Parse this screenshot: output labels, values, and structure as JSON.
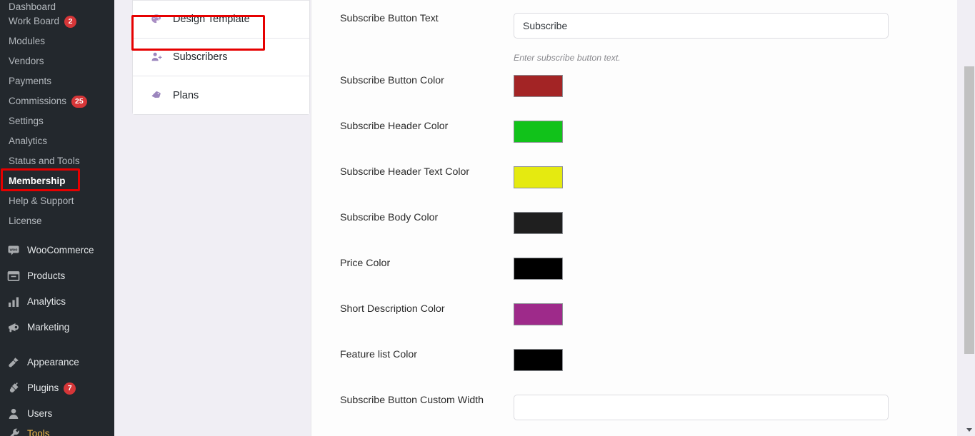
{
  "sidebar": {
    "items": [
      {
        "label": "Dashboard",
        "badge": null,
        "icon": null,
        "partial_top": true
      },
      {
        "label": "Work Board",
        "badge": "2",
        "icon": null
      },
      {
        "label": "Modules",
        "badge": null,
        "icon": null
      },
      {
        "label": "Vendors",
        "badge": null,
        "icon": null
      },
      {
        "label": "Payments",
        "badge": null,
        "icon": null
      },
      {
        "label": "Commissions",
        "badge": "25",
        "icon": null
      },
      {
        "label": "Settings",
        "badge": null,
        "icon": null
      },
      {
        "label": "Analytics",
        "badge": null,
        "icon": null
      },
      {
        "label": "Status and Tools",
        "badge": null,
        "icon": null
      },
      {
        "label": "Membership",
        "badge": null,
        "icon": null,
        "highlighted": true
      },
      {
        "label": "Help & Support",
        "badge": null,
        "icon": null
      },
      {
        "label": "License",
        "badge": null,
        "icon": null
      }
    ],
    "top_items": [
      {
        "label": "WooCommerce",
        "badge": null,
        "icon": "woocommerce-icon"
      },
      {
        "label": "Products",
        "badge": null,
        "icon": "products-icon"
      },
      {
        "label": "Analytics",
        "badge": null,
        "icon": "analytics-bars-icon"
      },
      {
        "label": "Marketing",
        "badge": null,
        "icon": "megaphone-icon"
      },
      {
        "label": "Appearance",
        "badge": null,
        "icon": "paintbrush-icon"
      },
      {
        "label": "Plugins",
        "badge": "7",
        "icon": "plug-icon"
      },
      {
        "label": "Users",
        "badge": null,
        "icon": "user-icon"
      },
      {
        "label": "Tools",
        "badge": null,
        "icon": "tools-icon"
      }
    ],
    "badge_color": "#d63638",
    "background": "#23282d"
  },
  "navpanel": {
    "items": [
      {
        "label": "Design Template",
        "icon": "palette-icon",
        "highlighted": true
      },
      {
        "label": "Subscribers",
        "icon": "user-plus-icon"
      },
      {
        "label": "Plans",
        "icon": "tag-icon"
      }
    ]
  },
  "highlight": {
    "color": "#e60000"
  },
  "form": {
    "rows": [
      {
        "label": "Subscribe Button Text",
        "type": "text",
        "value": "Subscribe",
        "placeholder": "",
        "helper": "Enter subscribe button text."
      },
      {
        "label": "Subscribe Button Color",
        "type": "color",
        "value": "#a32425"
      },
      {
        "label": "Subscribe Header Color",
        "type": "color",
        "value": "#11c21a"
      },
      {
        "label": "Subscribe Header Text Color",
        "type": "color",
        "value": "#e5ea10"
      },
      {
        "label": "Subscribe Body Color",
        "type": "color",
        "value": "#1f1f1f"
      },
      {
        "label": "Price Color",
        "type": "color",
        "value": "#000000"
      },
      {
        "label": "Short Description Color",
        "type": "color",
        "value": "#9e2a8a"
      },
      {
        "label": "Feature list Color",
        "type": "color",
        "value": "#000000"
      },
      {
        "label": "Subscribe Button Custom Width",
        "type": "text",
        "value": "",
        "placeholder": "",
        "helper": ""
      }
    ]
  },
  "scrollbar": {
    "vertical_visible": true,
    "down_arrow": "chevron-down-icon"
  }
}
